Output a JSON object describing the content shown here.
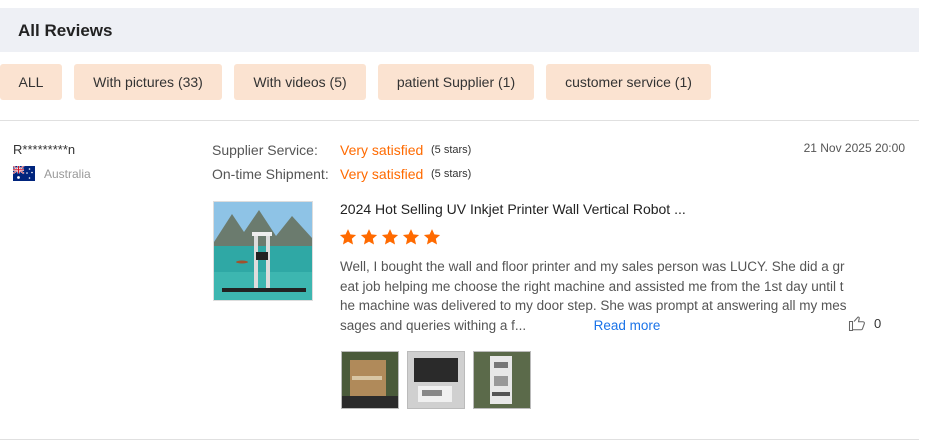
{
  "header": {
    "title": "All Reviews"
  },
  "filters": [
    {
      "label": "ALL"
    },
    {
      "label": "With pictures (33)"
    },
    {
      "label": "With videos (5)"
    },
    {
      "label": "patient Supplier (1)"
    },
    {
      "label": "customer service (1)"
    }
  ],
  "review": {
    "reviewer": "R*********n",
    "country": "Australia",
    "date": "21 Nov 2025 20:00",
    "ratings": [
      {
        "label": "Supplier Service:",
        "value": "Very satisfied",
        "stars": "(5 stars)"
      },
      {
        "label": "On-time Shipment:",
        "value": "Very satisfied",
        "stars": "(5 stars)"
      }
    ],
    "product_title": "2024 Hot Selling UV Inkjet Printer Wall Vertical Robot ...",
    "rating": 5,
    "text": "Well, I bought the wall and floor printer and my sales person was LUCY. She did a great job helping me choose the right machine and assisted me from the 1st day until the machine was delivered to my door step. She was prompt at answering all my messages and queries withing a f...",
    "read_more": "Read more",
    "helpful_count": "0",
    "photos": [
      "photo-1",
      "photo-2",
      "photo-3"
    ]
  },
  "colors": {
    "accent": "#ff6a00",
    "chip_bg": "#fbe3d1",
    "header_bg": "#eef0f5",
    "link": "#1a73e8"
  },
  "icons": [
    "star-icon",
    "thumbs-up-icon",
    "australia-flag-icon"
  ]
}
